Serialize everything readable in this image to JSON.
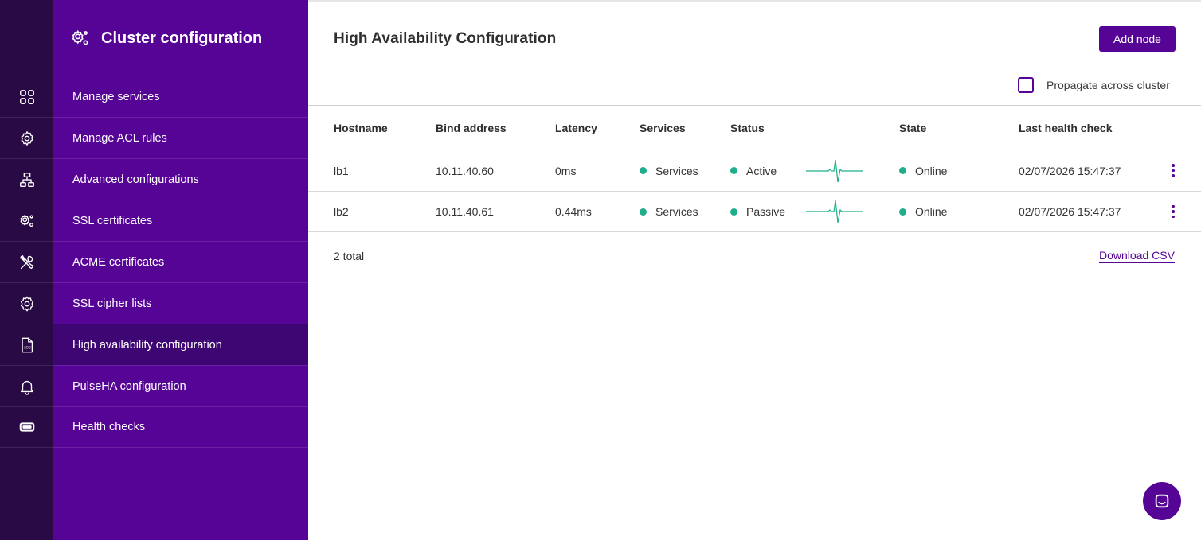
{
  "sidebar": {
    "title": "Cluster configuration",
    "items": [
      {
        "label": "Manage services",
        "icon": "grid-icon"
      },
      {
        "label": "Manage ACL rules",
        "icon": "gear-icon"
      },
      {
        "label": "Advanced configurations",
        "icon": "network-icon"
      },
      {
        "label": "SSL certificates",
        "icon": "gears-icon"
      },
      {
        "label": "ACME certificates",
        "icon": "tools-icon"
      },
      {
        "label": "SSL cipher lists",
        "icon": "settings-icon"
      },
      {
        "label": "High availability configuration",
        "icon": "log-file-icon",
        "active": true
      },
      {
        "label": "PulseHA configuration",
        "icon": "bell-icon"
      },
      {
        "label": "Health checks",
        "icon": "ticket-icon"
      }
    ]
  },
  "main": {
    "title": "High Availability Configuration",
    "add_button": "Add node",
    "propagate_label": "Propagate across cluster",
    "table": {
      "headers": [
        "Hostname",
        "Bind address",
        "Latency",
        "Services",
        "Status",
        "State",
        "Last health check"
      ],
      "rows": [
        {
          "hostname": "lb1",
          "bind": "10.11.40.60",
          "latency": "0ms",
          "services": "Services",
          "status": "Active",
          "state": "Online",
          "last_check": "02/07/2026 15:47:37"
        },
        {
          "hostname": "lb2",
          "bind": "10.11.40.61",
          "latency": "0.44ms",
          "services": "Services",
          "status": "Passive",
          "state": "Online",
          "last_check": "02/07/2026 15:47:37"
        }
      ]
    },
    "total": "2 total",
    "download": "Download CSV"
  },
  "colors": {
    "brand": "#560496",
    "rail": "#2a0a45",
    "status_green": "#1fae8b"
  }
}
